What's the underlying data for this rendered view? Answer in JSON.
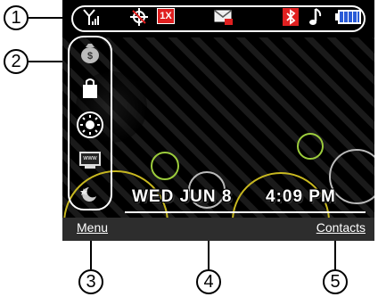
{
  "callouts": [
    "1",
    "2",
    "3",
    "4",
    "5"
  ],
  "status_bar": {
    "icons": [
      "signal-strength-icon",
      "gps-icon",
      "1x-network-icon",
      "message-icon",
      "bluetooth-icon",
      "music-note-icon",
      "battery-icon"
    ],
    "network_label": "1X"
  },
  "side_shortcuts": {
    "icons": [
      "money-bag-icon",
      "shopping-bag-icon",
      "brightness-icon",
      "web-browser-icon",
      "weather-icon"
    ],
    "www_label": "www"
  },
  "datetime": {
    "date": "WED JUN 8",
    "time": "4:09 PM"
  },
  "softkeys": {
    "left": "Menu",
    "right": "Contacts"
  },
  "colors": {
    "screen_bg": "#000000",
    "softkey_bar": "#2d2d2d",
    "status_red": "#e02020",
    "battery_blue": "#2a5bd7",
    "circle_green": "#9ccc3c",
    "circle_yellow": "#c8b820"
  }
}
